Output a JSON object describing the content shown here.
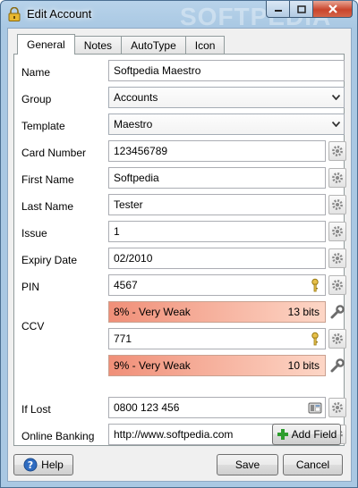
{
  "window": {
    "title": "Edit Account",
    "watermark": "SOFTPEDIA"
  },
  "tabs": [
    {
      "label": "General",
      "active": true
    },
    {
      "label": "Notes",
      "active": false
    },
    {
      "label": "AutoType",
      "active": false
    },
    {
      "label": "Icon",
      "active": false
    }
  ],
  "fields": {
    "name": {
      "label": "Name",
      "value": "Softpedia Maestro"
    },
    "group": {
      "label": "Group",
      "value": "Accounts"
    },
    "template": {
      "label": "Template",
      "value": "Maestro"
    },
    "card_number": {
      "label": "Card Number",
      "value": "123456789"
    },
    "first_name": {
      "label": "First Name",
      "value": "Softpedia"
    },
    "last_name": {
      "label": "Last Name",
      "value": "Tester"
    },
    "issue": {
      "label": "Issue",
      "value": "1"
    },
    "expiry_date": {
      "label": "Expiry Date",
      "value": "02/2010"
    },
    "pin": {
      "label": "PIN",
      "value": "4567",
      "strength_text": "8% - Very Weak",
      "strength_bits": "13 bits",
      "strength_percent": 8,
      "strength_color": "#f08f78"
    },
    "ccv": {
      "label": "CCV",
      "value": "771",
      "strength_text": "9% - Very Weak",
      "strength_bits": "10 bits",
      "strength_percent": 9,
      "strength_color": "#f08f78"
    },
    "if_lost": {
      "label": "If Lost",
      "value": "0800 123 456"
    },
    "online_banking": {
      "label": "Online Banking",
      "value": "http://www.softpedia.com"
    }
  },
  "buttons": {
    "add_field": "Add Field",
    "help": "Help",
    "save": "Save",
    "cancel": "Cancel"
  },
  "icons": {
    "title": "lock-icon",
    "field_options": "gear-icon",
    "password_reveal": "key-icon",
    "generator": "wrench-icon",
    "phone": "phone-icon",
    "web": "globe-icon",
    "add": "plus-icon",
    "help": "help-icon"
  },
  "colors": {
    "strength_low": "#f08f78",
    "strength_high": "#fdd6c6",
    "window_frame": "#a9c8e3",
    "close_button": "#c9452c",
    "add_icon": "#2e9e2e",
    "help_icon": "#2f6cc1"
  }
}
